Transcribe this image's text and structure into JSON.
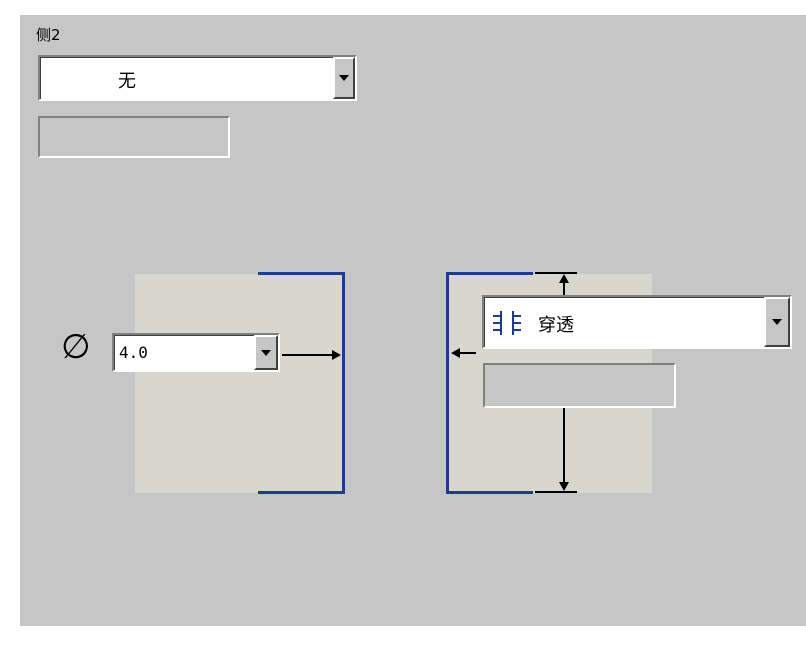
{
  "side2": {
    "label": "侧2",
    "dropdown_value": "无"
  },
  "hole": {
    "diameter_symbol": "∅",
    "diameter_value": "4.0"
  },
  "depth": {
    "dropdown_value": "穿透",
    "dropdown_icon": "through-all-icon"
  },
  "colors": {
    "panel_bg": "#c6c6c6",
    "preview_bg": "#d8d7cd",
    "blue_edge": "#1b3b9c"
  }
}
